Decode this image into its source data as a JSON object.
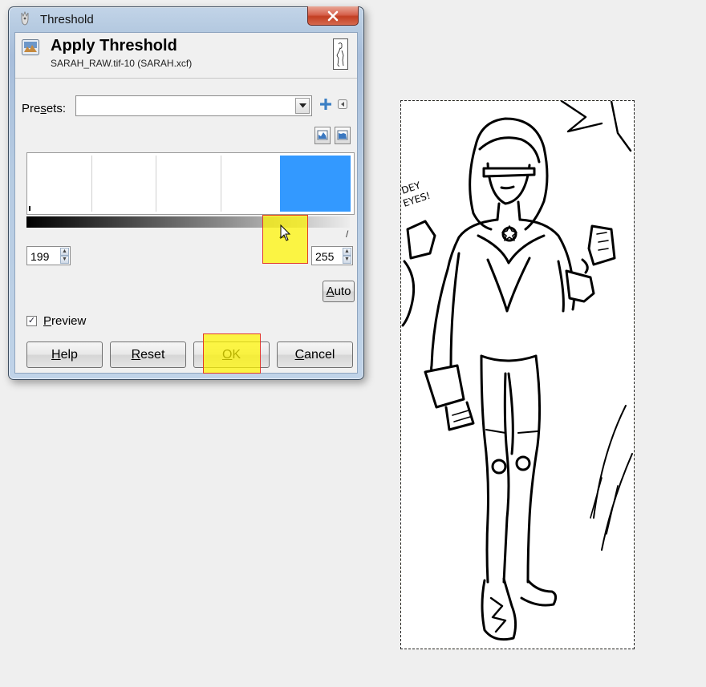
{
  "window": {
    "title": "Threshold",
    "close_glyph": "X"
  },
  "header": {
    "title": "Apply Threshold",
    "subtitle": "SARAH_RAW.tif-10 (SARAH.xcf)"
  },
  "presets": {
    "label_prefix": "Pre",
    "label_mnemonic": "s",
    "label_suffix": "ets:",
    "value": ""
  },
  "threshold": {
    "low": "199",
    "high": "255"
  },
  "buttons": {
    "auto_mnemonic": "A",
    "auto_rest": "uto",
    "help_mnemonic": "H",
    "help_rest": "elp",
    "reset_mnemonic": "R",
    "reset_rest": "eset",
    "ok_mnemonic": "O",
    "ok_rest": "K",
    "cancel_mnemonic": "C",
    "cancel_rest": "ancel"
  },
  "preview": {
    "checked": true,
    "mnemonic": "P",
    "rest": "review",
    "check_glyph": "✓"
  },
  "icons": {
    "title": "gimp-wilber-icon",
    "header": "threshold-tool-icon",
    "thumbnail": "image-thumbnail",
    "add": "plus-icon",
    "menu": "arrow-menu-icon",
    "linear": "linear-histogram-icon",
    "log": "logarithmic-histogram-icon"
  },
  "colors": {
    "selection": "#3399ff",
    "highlight": "#fff500",
    "highlight_border": "#e23b2a"
  },
  "canvas": {
    "lettering_line1": "DEY",
    "lettering_line2": "EYES!"
  }
}
